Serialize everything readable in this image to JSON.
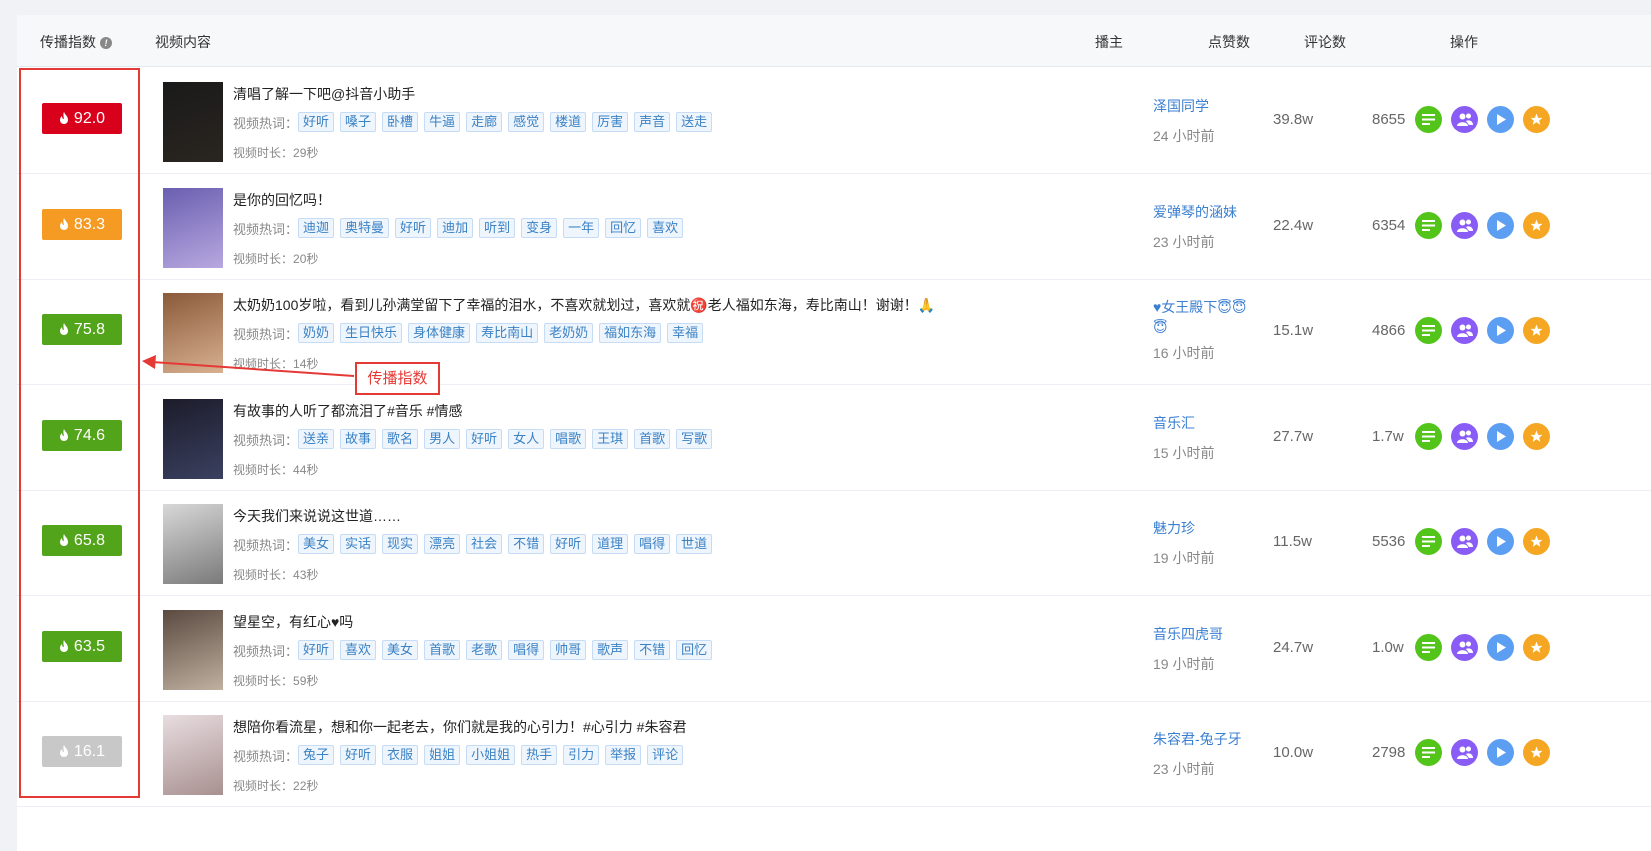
{
  "headers": {
    "index": "传播指数",
    "content": "视频内容",
    "author": "播主",
    "likes": "点赞数",
    "comments": "评论数",
    "actions": "操作"
  },
  "tags_label": "视频热词：",
  "duration_label": "视频时长：",
  "callout": "传播指数",
  "colors": {
    "red": "#d9001b",
    "orange": "#f59a23",
    "green": "#52a41a",
    "gray": "#c8c8c8",
    "accent": "#e53935"
  },
  "action_icons": [
    "list-icon",
    "fans-icon",
    "play-icon",
    "star-icon"
  ],
  "rows": [
    {
      "score": "92.0",
      "score_color": "red",
      "title": "清唱了解一下吧@抖音小助手",
      "tags": [
        "好听",
        "嗓子",
        "卧槽",
        "牛逼",
        "走廊",
        "感觉",
        "楼道",
        "厉害",
        "声音",
        "送走"
      ],
      "duration": "29秒",
      "author": "泽国同学",
      "ago": "24 小时前",
      "likes": "39.8w",
      "comments": "8655"
    },
    {
      "score": "83.3",
      "score_color": "orange",
      "title": "是你的回忆吗！",
      "tags": [
        "迪迦",
        "奥特曼",
        "好听",
        "迪加",
        "听到",
        "变身",
        "一年",
        "回忆",
        "喜欢"
      ],
      "duration": "20秒",
      "author": "爱弹琴的涵妹",
      "ago": "23 小时前",
      "likes": "22.4w",
      "comments": "6354"
    },
    {
      "score": "75.8",
      "score_color": "green",
      "title": "太奶奶100岁啦，看到儿孙满堂留下了幸福的泪水，不喜欢就划过，喜欢就㊗️老人福如东海，寿比南山！谢谢！🙏",
      "tags": [
        "奶奶",
        "生日快乐",
        "身体健康",
        "寿比南山",
        "老奶奶",
        "福如东海",
        "幸福"
      ],
      "duration": "14秒",
      "author": "♥女王殿下😇😇😇",
      "ago": "16 小时前",
      "likes": "15.1w",
      "comments": "4866"
    },
    {
      "score": "74.6",
      "score_color": "green",
      "title": "有故事的人听了都流泪了#音乐 #情感",
      "tags": [
        "送亲",
        "故事",
        "歌名",
        "男人",
        "好听",
        "女人",
        "唱歌",
        "王琪",
        "首歌",
        "写歌"
      ],
      "duration": "44秒",
      "author": "音乐汇",
      "ago": "15 小时前",
      "likes": "27.7w",
      "comments": "1.7w"
    },
    {
      "score": "65.8",
      "score_color": "green",
      "title": "今天我们来说说这世道……",
      "tags": [
        "美女",
        "实话",
        "现实",
        "漂亮",
        "社会",
        "不错",
        "好听",
        "道理",
        "唱得",
        "世道"
      ],
      "duration": "43秒",
      "author": "魅力珍",
      "ago": "19 小时前",
      "likes": "11.5w",
      "comments": "5536"
    },
    {
      "score": "63.5",
      "score_color": "green",
      "title": "望星空，有红心♥吗",
      "tags": [
        "好听",
        "喜欢",
        "美女",
        "首歌",
        "老歌",
        "唱得",
        "帅哥",
        "歌声",
        "不错",
        "回忆"
      ],
      "duration": "59秒",
      "author": "音乐四虎哥",
      "ago": "19 小时前",
      "likes": "24.7w",
      "comments": "1.0w"
    },
    {
      "score": "16.1",
      "score_color": "gray",
      "title": "想陪你看流星，想和你一起老去，你们就是我的心引力！#心引力 #朱容君",
      "tags": [
        "兔子",
        "好听",
        "衣服",
        "姐姐",
        "小姐姐",
        "热手",
        "引力",
        "举报",
        "评论"
      ],
      "duration": "22秒",
      "author": "朱容君-兔子牙",
      "ago": "23 小时前",
      "likes": "10.0w",
      "comments": "2798"
    }
  ]
}
